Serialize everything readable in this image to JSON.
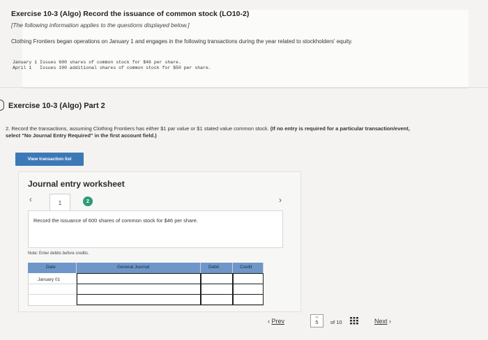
{
  "exercise": {
    "title": "Exercise 10-3 (Algo) Record the issuance of common stock (LO10-2)",
    "note": "[The following information applies to the questions displayed below.]",
    "description": "Clothing Frontiers began operations on January 1 and engages in the following transactions during the year related to stockholders' equity.",
    "transactions": [
      "January 1 Issues 600 shares of common stock for $46 per share.",
      "April 1   Issues 100 additional shares of common stock for $50 per share."
    ]
  },
  "part": {
    "title": "Exercise 10-3 (Algo) Part 2",
    "instruction_main": "2. Record the transactions, assuming Clothing Frontiers has either $1 par value or $1 stated value common stock.",
    "instruction_bold": "(If no entry is required for a particular transaction/event, select \"No Journal Entry Required\" in the first account field.)"
  },
  "view_button_label": "View transaction list",
  "worksheet": {
    "title": "Journal entry worksheet",
    "tabs": [
      "1",
      "2"
    ],
    "active_tab": "1",
    "task_text": "Record the issuance of 600 shares of common stock for $46 per share.",
    "note": "Note: Enter debits before credits.",
    "columns": [
      "Date",
      "General Journal",
      "Debit",
      "Credit"
    ],
    "rows": [
      {
        "date": "January 01",
        "account": "",
        "debit": "",
        "credit": ""
      },
      {
        "date": "",
        "account": "",
        "debit": "",
        "credit": ""
      },
      {
        "date": "",
        "account": "",
        "debit": "",
        "credit": ""
      }
    ]
  },
  "pagination": {
    "prev_label": "Prev",
    "current_page": "5",
    "mini_label": "∞",
    "total_label": "of 10",
    "next_label": "Next"
  },
  "colors": {
    "table_header": "#6e96c9",
    "button": "#3c79b6",
    "tab_active": "#2f9a78"
  }
}
